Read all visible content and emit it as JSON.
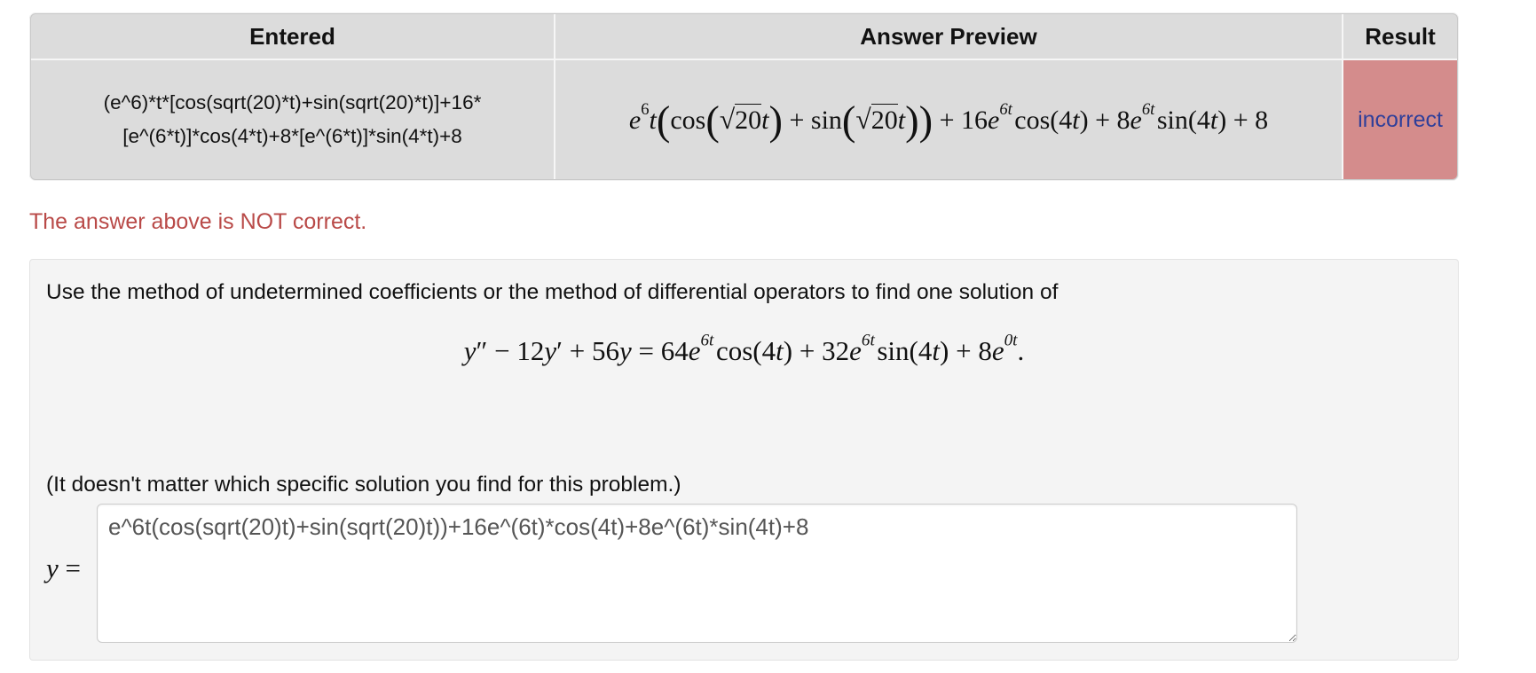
{
  "results_table": {
    "headers": {
      "entered": "Entered",
      "preview": "Answer Preview",
      "result": "Result"
    },
    "row": {
      "entered_line1": "(e^6)*t*[cos(sqrt(20)*t)+sin(sqrt(20)*t)]+16*",
      "entered_line2": "[e^(6*t)]*cos(4*t)+8*[e^(6*t)]*sin(4*t)+8",
      "preview_latex": "e^6t\\left(\\cos\\left(\\sqrt{20}t\\right)+\\sin\\left(\\sqrt{20}t\\right)\\right)+16e^{6t}\\cos(4t)+8e^{6t}\\sin(4t)+8",
      "preview_parts": {
        "e": "e",
        "e_exp": "6",
        "t": "t",
        "cos": "cos",
        "sin": "sin",
        "sqrt_arg": "20",
        "plus": "+",
        "c16": "16",
        "c8": "8",
        "exp_6t": "6t",
        "arg_4t_num": "4",
        "const": "8"
      },
      "result": "incorrect"
    },
    "colors": {
      "header_bg": "#dcdcdc",
      "incorrect_bg": "#d48c8c",
      "incorrect_text": "#2f3f9a"
    }
  },
  "feedback": {
    "message": "The answer above is NOT correct.",
    "color": "#b94a48"
  },
  "problem": {
    "prompt": "Use the method of undetermined coefficients or the method of differential operators to find one solution of",
    "equation_latex": "y'' - 12y' + 56y = 64e^{6t}\\cos(4t) + 32e^{6t}\\sin(4t) + 8e^{0t}.",
    "equation_parts": {
      "c12": "12",
      "c56": "56",
      "c64": "64",
      "c32": "32",
      "c8": "8",
      "exp1": "6t",
      "exp2": "6t",
      "exp3": "0t"
    },
    "note": "(It doesn't matter which specific solution you find for this problem.)",
    "answer_label": "y =",
    "answer_value": "e^6t(cos(sqrt(20)t)+sin(sqrt(20)t))+16e^(6t)*cos(4t)+8e^(6t)*sin(4t)+8"
  }
}
